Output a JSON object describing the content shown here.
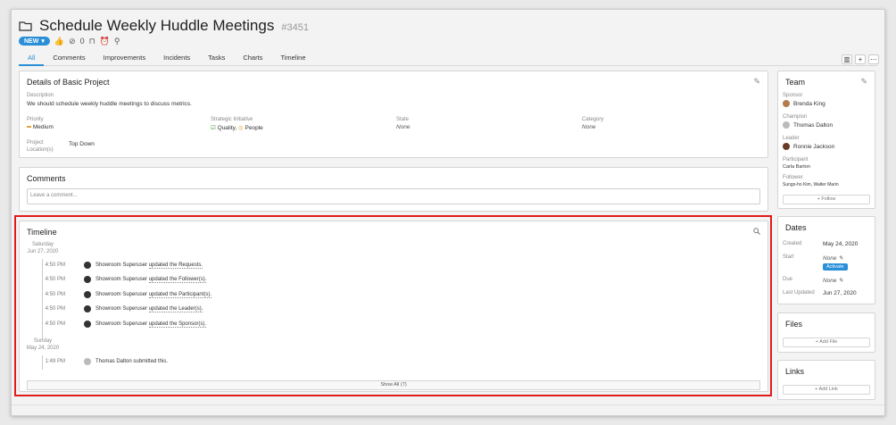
{
  "header": {
    "title": "Schedule Weekly Huddle Meetings",
    "number": "#3451",
    "status_label": "NEW",
    "approvals_count": "0"
  },
  "tabs": [
    "All",
    "Comments",
    "Improvements",
    "Incidents",
    "Tasks",
    "Charts",
    "Timeline"
  ],
  "details": {
    "title": "Details of Basic Project",
    "description_label": "Description",
    "description": "We should schedule weekly huddle meetings to discuss metrics.",
    "priority_label": "Priority",
    "priority": "Medium",
    "strategic_label": "Strategic Initiative",
    "strategic_quality": "Quality,",
    "strategic_people": "People",
    "state_label": "State",
    "state": "None",
    "category_label": "Category",
    "category": "None",
    "location_label": "Project Location(s)",
    "location": "Top Down"
  },
  "comments": {
    "title": "Comments",
    "placeholder": "Leave a comment..."
  },
  "timeline": {
    "title": "Timeline",
    "day1_weekday": "Saturday",
    "day1_date": "Jun 27, 2020",
    "events": [
      {
        "time": "4:50 PM",
        "actor": "Showroom Superuser",
        "text": "updated the Requests."
      },
      {
        "time": "4:50 PM",
        "actor": "Showroom Superuser",
        "text": "updated the Follower(s)."
      },
      {
        "time": "4:50 PM",
        "actor": "Showroom Superuser",
        "text": "updated the Participant(s)."
      },
      {
        "time": "4:50 PM",
        "actor": "Showroom Superuser",
        "text": "updated the Leader(s)."
      },
      {
        "time": "4:50 PM",
        "actor": "Showroom Superuser",
        "text": "updated the Sponsor(s)."
      }
    ],
    "day2_weekday": "Sunday",
    "day2_date": "May 24, 2020",
    "submit_time": "1:49 PM",
    "submit_text": "Thomas Dalton submitted this.",
    "show_all": "Show All (7)"
  },
  "team": {
    "title": "Team",
    "sponsor_label": "Sponsor",
    "sponsor": "Brenda King",
    "champion_label": "Champion",
    "champion": "Thomas Dalton",
    "leader_label": "Leader",
    "leader": "Ronnie Jackson",
    "participant_label": "Participant",
    "participant": "Carla Barton",
    "follower_label": "Follower",
    "follower": "Sungo-ho Kim, Walter Marin",
    "follow_button": "Follow"
  },
  "dates": {
    "title": "Dates",
    "created_label": "Created",
    "created": "May 24, 2020",
    "start_label": "Start",
    "start": "None",
    "activate_button": "Activate",
    "due_label": "Due",
    "due": "None",
    "updated_label": "Last Updated",
    "updated": "Jun 27, 2020"
  },
  "files": {
    "title": "Files",
    "add_button": "Add File"
  },
  "links": {
    "title": "Links",
    "add_button": "Add Link"
  },
  "colors": {
    "accent": "#2a8fd8",
    "highlight": "#e01b1b"
  }
}
